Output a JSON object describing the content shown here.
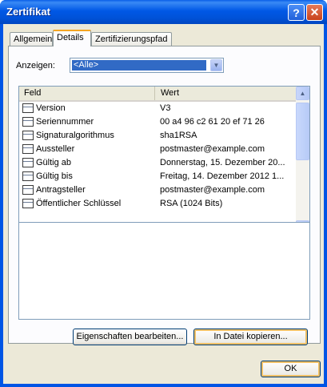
{
  "window": {
    "title": "Zertifikat"
  },
  "tabs": [
    {
      "label": "Allgemein"
    },
    {
      "label": "Details"
    },
    {
      "label": "Zertifizierungspfad"
    }
  ],
  "show": {
    "label": "Anzeigen:",
    "selected": "<Alle>"
  },
  "table": {
    "headers": {
      "field": "Feld",
      "value": "Wert"
    },
    "rows": [
      {
        "field": "Version",
        "value": "V3"
      },
      {
        "field": "Seriennummer",
        "value": "00 a4 96 c2 61 20 ef 71 26"
      },
      {
        "field": "Signaturalgorithmus",
        "value": "sha1RSA"
      },
      {
        "field": "Aussteller",
        "value": "postmaster@example.com"
      },
      {
        "field": "Gültig ab",
        "value": "Donnerstag, 15. Dezember 20..."
      },
      {
        "field": "Gültig bis",
        "value": "Freitag, 14. Dezember 2012 1..."
      },
      {
        "field": "Antragsteller",
        "value": "postmaster@example.com"
      },
      {
        "field": "Öffentlicher Schlüssel",
        "value": "RSA (1024 Bits)"
      }
    ]
  },
  "buttons": {
    "edit_properties": "Eigenschaften bearbeiten...",
    "copy_to_file": "In Datei kopieren...",
    "ok": "OK"
  }
}
